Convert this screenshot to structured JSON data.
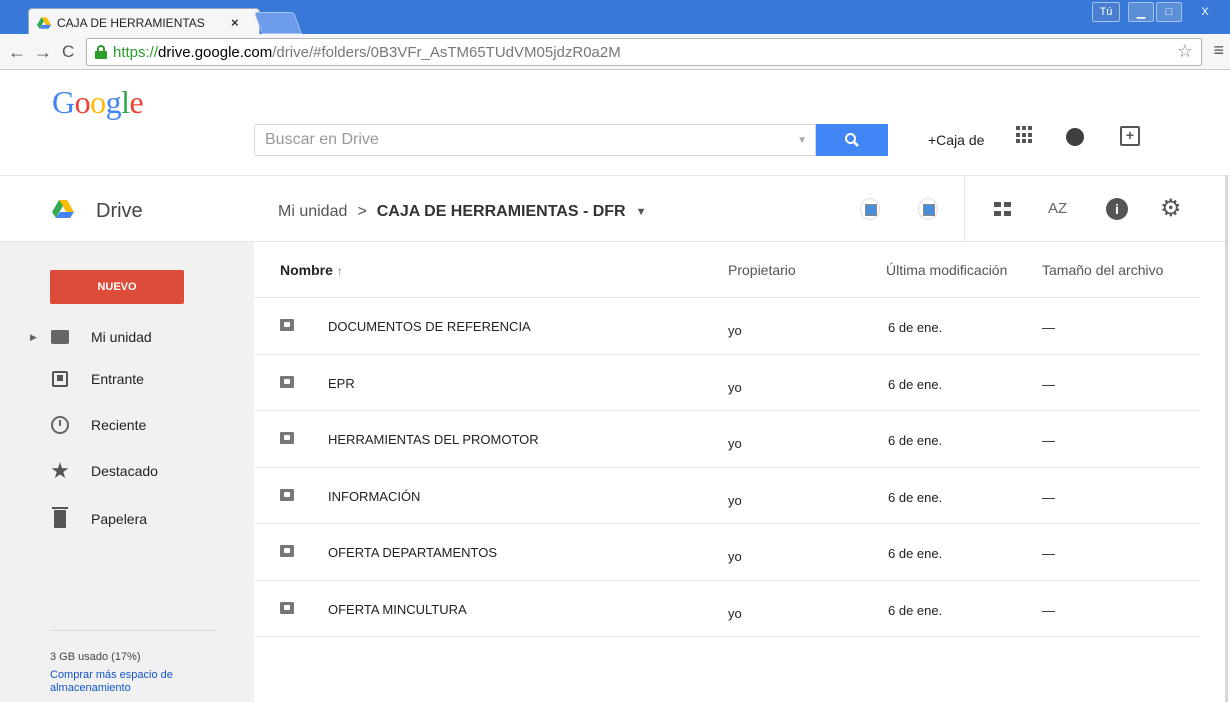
{
  "browser": {
    "tab_title": "CAJA DE HERRAMIENTAS",
    "tab_close": "×",
    "user_badge": "Tú",
    "url_scheme": "https://",
    "url_host": "drive.google.com",
    "url_path": "/drive/#folders/0B3VFr_AsTM65TUdVM05jdzR0a2M"
  },
  "gbar": {
    "logo": [
      "G",
      "o",
      "o",
      "g",
      "l",
      "e"
    ],
    "logo_colors": [
      "#4285f4",
      "#ea4335",
      "#fbbc05",
      "#4285f4",
      "#34a853",
      "#ea4335"
    ],
    "search_placeholder": "Buscar en Drive",
    "caja_link": "+Caja de"
  },
  "subbar": {
    "drive_title": "Drive",
    "breadcrumb_root": "Mi unidad",
    "breadcrumb_sep": ">",
    "breadcrumb_current": "CAJA DE HERRAMIENTAS - DFR",
    "sort_label": "AZ",
    "info_label": "i"
  },
  "sidebar": {
    "new_button": "NUEVO",
    "items": [
      {
        "label": "Mi unidad",
        "icon": "folder-icon"
      },
      {
        "label": "Entrante",
        "icon": "inbox-icon"
      },
      {
        "label": "Reciente",
        "icon": "clock-icon"
      },
      {
        "label": "Destacado",
        "icon": "star-icon"
      },
      {
        "label": "Papelera",
        "icon": "trash-icon"
      }
    ],
    "storage_used": "3 GB usado (17%)",
    "storage_buy": "Comprar más espacio de almacenamiento"
  },
  "list": {
    "headers": {
      "name": "Nombre",
      "sort_arrow": "↑",
      "owner": "Propietario",
      "modified": "Última modificación",
      "size": "Tamaño del archivo"
    },
    "rows": [
      {
        "name": "DOCUMENTOS DE REFERENCIA",
        "owner": "yo",
        "modified": "6 de ene.",
        "size": "—"
      },
      {
        "name": "EPR",
        "owner": "yo",
        "modified": "6 de ene.",
        "size": "—"
      },
      {
        "name": "HERRAMIENTAS DEL PROMOTOR",
        "owner": "yo",
        "modified": "6 de ene.",
        "size": "—"
      },
      {
        "name": "INFORMACIÓN",
        "owner": "yo",
        "modified": "6 de ene.",
        "size": "—"
      },
      {
        "name": "OFERTA DEPARTAMENTOS",
        "owner": "yo",
        "modified": "6 de ene.",
        "size": "—"
      },
      {
        "name": "OFERTA MINCULTURA",
        "owner": "yo",
        "modified": "6 de ene.",
        "size": "—"
      }
    ]
  }
}
